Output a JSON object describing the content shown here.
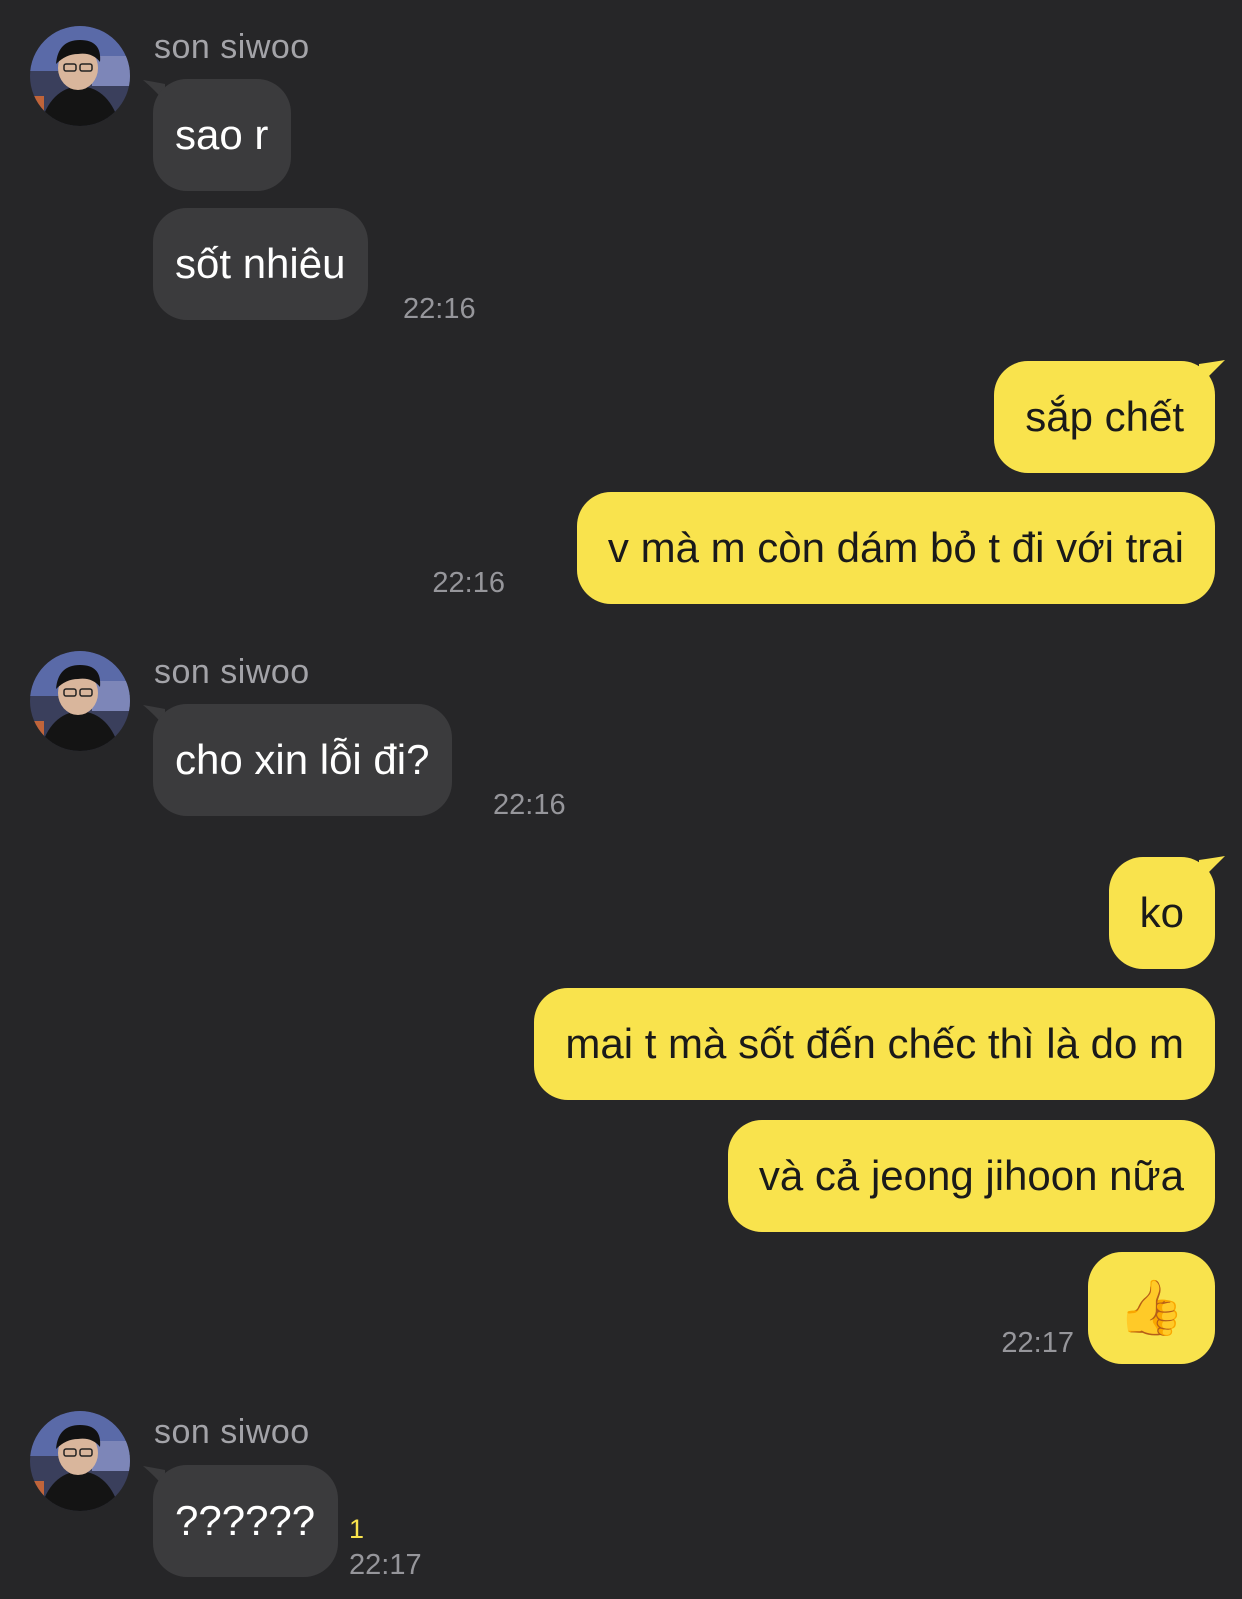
{
  "contact": {
    "name": "son siwoo"
  },
  "colors": {
    "background": "#262628",
    "incoming_bubble": "#3b3b3d",
    "outgoing_bubble": "#f9e34d",
    "timestamp": "#96969b",
    "sender_name": "#a3a3a8",
    "unread_count": "#f9e34d"
  },
  "groups": [
    {
      "direction": "incoming",
      "sender": "son siwoo",
      "messages": [
        "sao r",
        "sốt nhiêu"
      ],
      "time": "22:16"
    },
    {
      "direction": "outgoing",
      "messages": [
        "sắp chết",
        "v mà m còn dám bỏ t đi với trai"
      ],
      "time": "22:16"
    },
    {
      "direction": "incoming",
      "sender": "son siwoo",
      "messages": [
        "cho xin lỗi đi?"
      ],
      "time": "22:16"
    },
    {
      "direction": "outgoing",
      "messages": [
        "ko",
        "mai t mà sốt đến chếc thì là do m",
        "và cả jeong jihoon nữa",
        "👍"
      ],
      "time": "22:17"
    },
    {
      "direction": "incoming",
      "sender": "son siwoo",
      "messages": [
        "??????"
      ],
      "time": "22:17",
      "unread": "1"
    }
  ],
  "icons": {
    "avatar": "profile-photo-avatar",
    "thumbs_up": "thumbs-up-emoji"
  }
}
